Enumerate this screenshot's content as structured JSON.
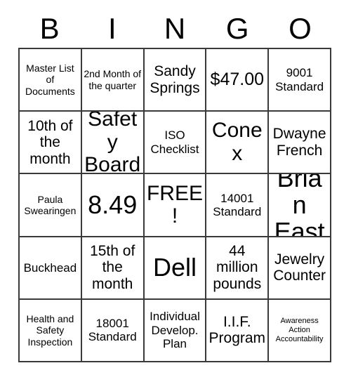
{
  "card": {
    "header_letters": [
      "B",
      "I",
      "N",
      "G",
      "O"
    ],
    "columns": 5,
    "rows": 5,
    "border_color": "#3a3a3a",
    "background_color": "#ffffff",
    "text_color": "#000000",
    "free_space_label": "FREE!",
    "cells": [
      [
        {
          "text": "Master List of Documents",
          "size": "sm"
        },
        {
          "text": "2nd Month of the quarter",
          "size": "sm"
        },
        {
          "text": "Sandy Springs",
          "size": "lg"
        },
        {
          "text": "$47.00",
          "size": "xl"
        },
        {
          "text": "9001 Standard",
          "size": "md"
        }
      ],
      [
        {
          "text": "10th of the month",
          "size": "lg"
        },
        {
          "text": "Safety Board",
          "size": "xxl"
        },
        {
          "text": "ISO Checklist",
          "size": "md"
        },
        {
          "text": "Conex",
          "size": "xxl"
        },
        {
          "text": "Dwayne French",
          "size": "lg"
        }
      ],
      [
        {
          "text": "Paula Swearingen",
          "size": "sm"
        },
        {
          "text": "8.49",
          "size": "huge"
        },
        {
          "text": "FREE!",
          "size": "xxl"
        },
        {
          "text": "14001 Standard",
          "size": "md"
        },
        {
          "text": "Brian East",
          "size": "huge"
        }
      ],
      [
        {
          "text": "Buckhead",
          "size": "md"
        },
        {
          "text": "15th of the month",
          "size": "lg"
        },
        {
          "text": "Dell",
          "size": "huge"
        },
        {
          "text": "44 million pounds",
          "size": "lg"
        },
        {
          "text": "Jewelry Counter",
          "size": "lg"
        }
      ],
      [
        {
          "text": "Health and Safety Inspection",
          "size": "sm"
        },
        {
          "text": "18001 Standard",
          "size": "md"
        },
        {
          "text": "Individual Develop. Plan",
          "size": "md"
        },
        {
          "text": "I.I.F. Program",
          "size": "lg"
        },
        {
          "text": "Awareness Action Accountability",
          "size": "xs"
        }
      ]
    ]
  }
}
